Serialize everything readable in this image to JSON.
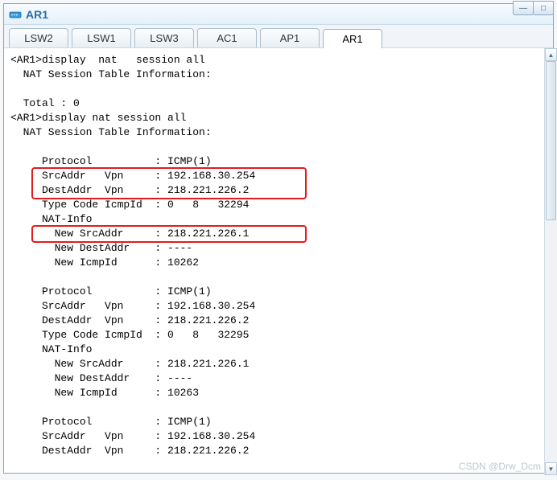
{
  "title": "AR1",
  "winbtns": {
    "min": "—",
    "max": "□"
  },
  "tabs": [
    {
      "label": "LSW2",
      "active": false
    },
    {
      "label": "LSW1",
      "active": false
    },
    {
      "label": "LSW3",
      "active": false
    },
    {
      "label": "AC1",
      "active": false
    },
    {
      "label": "AP1",
      "active": false
    },
    {
      "label": "AR1",
      "active": true
    }
  ],
  "term": {
    "l0": "<AR1>display  nat   session all",
    "l1": "  NAT Session Table Information:",
    "l2": "",
    "l3": "  Total : 0",
    "l4": "<AR1>display nat session all",
    "l5": "  NAT Session Table Information:",
    "l6": "",
    "l7": "     Protocol          : ICMP(1)",
    "l8": "     SrcAddr   Vpn     : 192.168.30.254",
    "l9": "     DestAddr  Vpn     : 218.221.226.2",
    "l10": "     Type Code IcmpId  : 0   8   32294",
    "l11": "     NAT-Info",
    "l12": "       New SrcAddr     : 218.221.226.1",
    "l13": "       New DestAddr    : ----",
    "l14": "       New IcmpId      : 10262",
    "l15": "",
    "l16": "     Protocol          : ICMP(1)",
    "l17": "     SrcAddr   Vpn     : 192.168.30.254",
    "l18": "     DestAddr  Vpn     : 218.221.226.2",
    "l19": "     Type Code IcmpId  : 0   8   32295",
    "l20": "     NAT-Info",
    "l21": "       New SrcAddr     : 218.221.226.1",
    "l22": "       New DestAddr    : ----",
    "l23": "       New IcmpId      : 10263",
    "l24": "",
    "l25": "     Protocol          : ICMP(1)",
    "l26": "     SrcAddr   Vpn     : 192.168.30.254",
    "l27": "     DestAddr  Vpn     : 218.221.226.2"
  },
  "credit": "CSDN @Drw_Dcm"
}
